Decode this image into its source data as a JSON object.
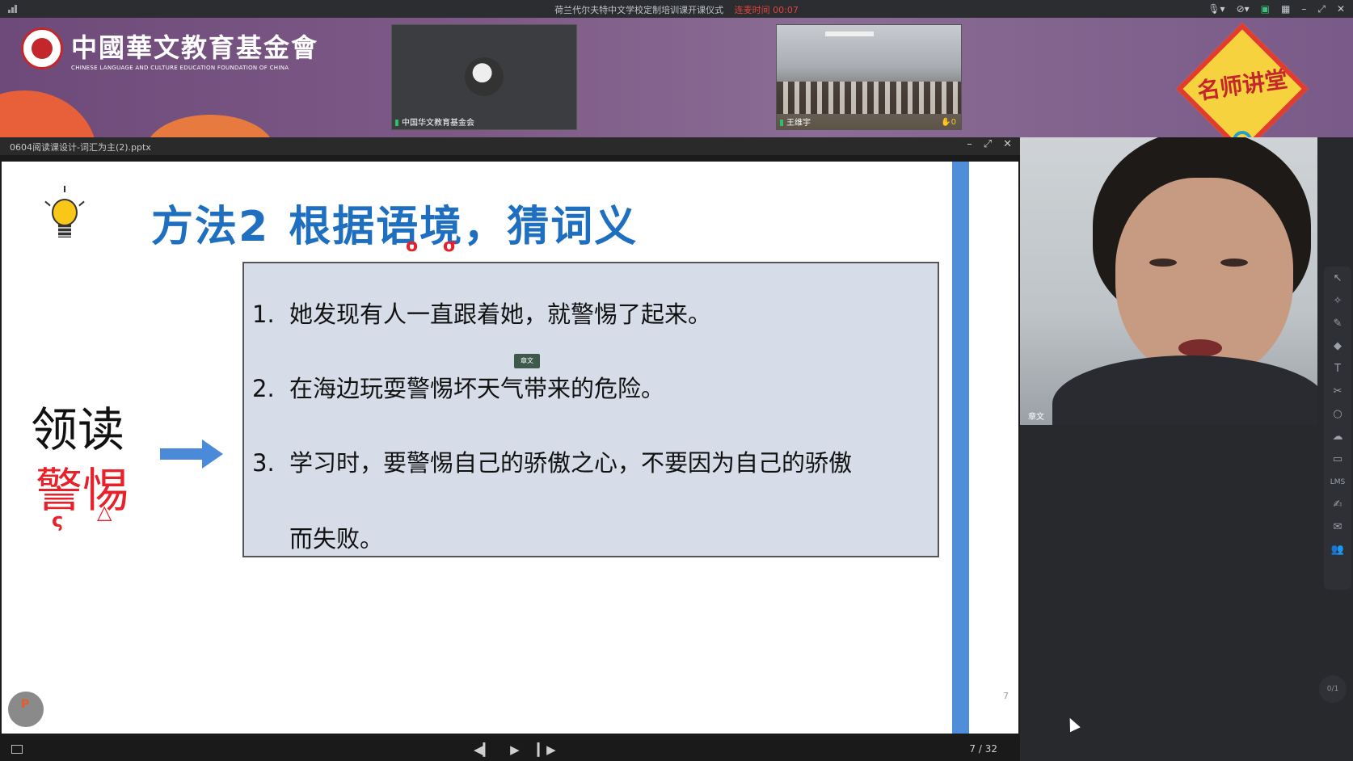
{
  "titlebar": {
    "title": "荷兰代尔夫特中文学校定制培训课开课仪式",
    "timer_label": "连麦时间",
    "timer_value": "00:07"
  },
  "banner": {
    "org_name_cn": "中國華文教育基金會",
    "org_name_en": "CHINESE LANGUAGE AND CULTURE EDUCATION FOUNDATION OF CHINA",
    "badge_text": "名师讲堂"
  },
  "videos": [
    {
      "name": "中国华文教育基金会"
    },
    {
      "name": "王维宇",
      "hand_count": "0"
    }
  ],
  "presentation": {
    "filename": "0604阅读课设计-词汇为主(2).pptx",
    "slide": {
      "method": "方法2",
      "title": "根据语境，猜词义",
      "read_label": "领读",
      "word": "警惕",
      "items": [
        {
          "num": "1.",
          "text": "她发现有人一直跟着她，就警惕了起来。"
        },
        {
          "num": "2.",
          "text": "在海边玩耍警惕坏天气带来的危险。"
        },
        {
          "num": "3.",
          "text": "学习时，要警惕自己的骄傲之心，不要因为自己的骄傲"
        },
        {
          "num": "",
          "text": "而失败。"
        }
      ],
      "tooltip": "章文",
      "page_number": "7"
    },
    "pages": "7 / 32"
  },
  "speaker": {
    "name": "章文"
  },
  "tools": [
    "pointer",
    "laser",
    "pen",
    "eraser",
    "text",
    "scissors",
    "circle",
    "cloud",
    "briefcase",
    "lms",
    "edit",
    "chat",
    "users"
  ],
  "raise_hand": "0/1"
}
